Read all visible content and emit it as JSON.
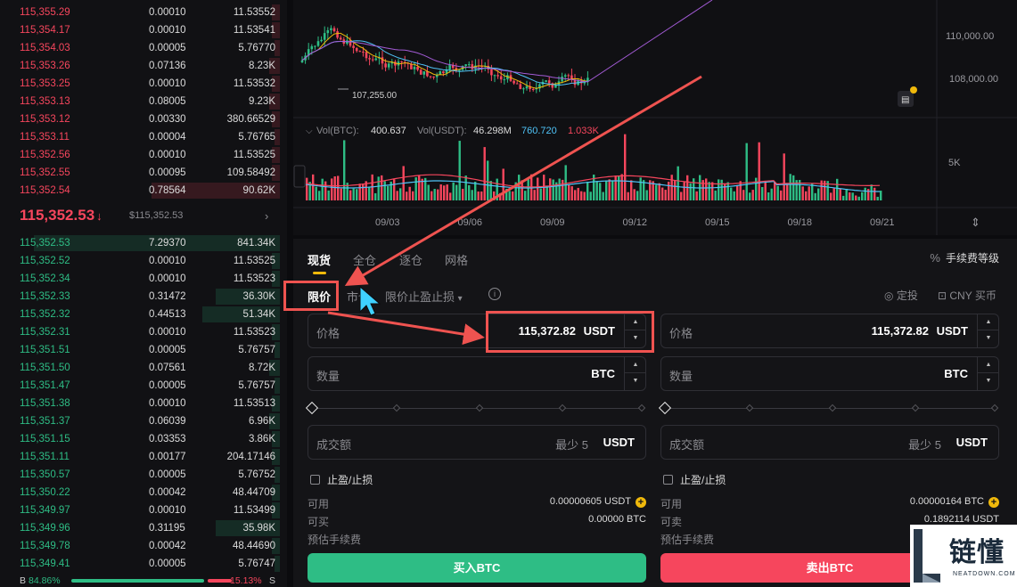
{
  "orderbook": {
    "asks": [
      {
        "price": "115,355.29",
        "qty": "0.00010",
        "total": "11.53552",
        "depth": 0.03
      },
      {
        "price": "115,354.17",
        "qty": "0.00010",
        "total": "11.53541",
        "depth": 0.03
      },
      {
        "price": "115,354.03",
        "qty": "0.00005",
        "total": "5.76770",
        "depth": 0.02
      },
      {
        "price": "115,353.26",
        "qty": "0.07136",
        "total": "8.23K",
        "depth": 0.04
      },
      {
        "price": "115,353.25",
        "qty": "0.00010",
        "total": "11.53532",
        "depth": 0.03
      },
      {
        "price": "115,353.13",
        "qty": "0.08005",
        "total": "9.23K",
        "depth": 0.04
      },
      {
        "price": "115,353.12",
        "qty": "0.00330",
        "total": "380.66529",
        "depth": 0.03
      },
      {
        "price": "115,353.11",
        "qty": "0.00004",
        "total": "5.76765",
        "depth": 0.02
      },
      {
        "price": "115,352.56",
        "qty": "0.00010",
        "total": "11.53525",
        "depth": 0.03
      },
      {
        "price": "115,352.55",
        "qty": "0.00095",
        "total": "109.58492",
        "depth": 0.03
      },
      {
        "price": "115,352.54",
        "qty": "0.78564",
        "total": "90.62K",
        "depth": 0.48
      }
    ],
    "last_price": "115,352.53",
    "last_arrow": "↓",
    "last_usd": "$115,352.53",
    "chevron": "›",
    "bids": [
      {
        "price": "115,352.53",
        "qty": "7.29370",
        "total": "841.34K",
        "depth": 0.92
      },
      {
        "price": "115,352.52",
        "qty": "0.00010",
        "total": "11.53525",
        "depth": 0.03
      },
      {
        "price": "115,352.34",
        "qty": "0.00010",
        "total": "11.53523",
        "depth": 0.03
      },
      {
        "price": "115,352.33",
        "qty": "0.31472",
        "total": "36.30K",
        "depth": 0.24
      },
      {
        "price": "115,352.32",
        "qty": "0.44513",
        "total": "51.34K",
        "depth": 0.29
      },
      {
        "price": "115,352.31",
        "qty": "0.00010",
        "total": "11.53523",
        "depth": 0.03
      },
      {
        "price": "115,351.51",
        "qty": "0.00005",
        "total": "5.76757",
        "depth": 0.02
      },
      {
        "price": "115,351.50",
        "qty": "0.07561",
        "total": "8.72K",
        "depth": 0.04
      },
      {
        "price": "115,351.47",
        "qty": "0.00005",
        "total": "5.76757",
        "depth": 0.02
      },
      {
        "price": "115,351.38",
        "qty": "0.00010",
        "total": "11.53513",
        "depth": 0.03
      },
      {
        "price": "115,351.37",
        "qty": "0.06039",
        "total": "6.96K",
        "depth": 0.04
      },
      {
        "price": "115,351.15",
        "qty": "0.03353",
        "total": "3.86K",
        "depth": 0.03
      },
      {
        "price": "115,351.11",
        "qty": "0.00177",
        "total": "204.17146",
        "depth": 0.03
      },
      {
        "price": "115,350.57",
        "qty": "0.00005",
        "total": "5.76752",
        "depth": 0.02
      },
      {
        "price": "115,350.22",
        "qty": "0.00042",
        "total": "48.44709",
        "depth": 0.03
      },
      {
        "price": "115,349.97",
        "qty": "0.00010",
        "total": "11.53499",
        "depth": 0.03
      },
      {
        "price": "115,349.96",
        "qty": "0.31195",
        "total": "35.98K",
        "depth": 0.24
      },
      {
        "price": "115,349.78",
        "qty": "0.00042",
        "total": "48.44690",
        "depth": 0.03
      },
      {
        "price": "115,349.41",
        "qty": "0.00005",
        "total": "5.76747",
        "depth": 0.02
      }
    ],
    "ratio": {
      "b_label": "B",
      "b_pct": "84.86%",
      "s_pct": "15.13%",
      "s_label": "S",
      "b_fraction": 0.8486
    }
  },
  "chart": {
    "price_labels": [
      "110,000.00",
      "108,000.00"
    ],
    "low_marker": "107,255.00",
    "vol_header": {
      "vol_btc_label": "Vol(BTC):",
      "vol_btc": "400.637",
      "vol_usdt_label": "Vol(USDT):",
      "vol_usdt": "46.298M",
      "ma1": "760.720",
      "ma2": "1.033K"
    },
    "vol_axis_label": "5K",
    "dates": [
      "09/03",
      "09/06",
      "09/09",
      "09/12",
      "09/15",
      "09/18",
      "09/21"
    ],
    "colors": {
      "up": "#2ebd85",
      "down": "#f6465d",
      "ma_yellow": "#f0b90b",
      "ma_purple": "#a35bd6",
      "ma_cyan": "#4fc3f7"
    }
  },
  "trade": {
    "tabs": [
      "现货",
      "全仓",
      "逐仓",
      "网格"
    ],
    "fee_icon": "%",
    "fee_level": "手续费等级",
    "order_types": [
      "限价",
      "市价",
      "限价止盈止损"
    ],
    "dropdown_caret": "▾",
    "info_glyph": "i",
    "fixed_cast": "定投",
    "cny_buy": "CNY 买币",
    "buy": {
      "price_label": "价格",
      "price_value": "115,372.82",
      "price_unit": "USDT",
      "amount_label": "数量",
      "amount_unit": "BTC",
      "total_label": "成交额",
      "total_min": "最少 5",
      "total_unit": "USDT",
      "tpsl_label": "止盈/止损",
      "avail_label": "可用",
      "avail_value": "0.00000605 USDT",
      "can_label": "可买",
      "can_value": "0.00000 BTC",
      "fee_label": "预估手续费",
      "button": "买入BTC"
    },
    "sell": {
      "price_label": "价格",
      "price_value": "115,372.82",
      "price_unit": "USDT",
      "amount_label": "数量",
      "amount_unit": "BTC",
      "total_label": "成交额",
      "total_min": "最少 5",
      "total_unit": "USDT",
      "tpsl_label": "止盈/止损",
      "avail_label": "可用",
      "avail_value": "0.00000164 BTC",
      "can_label": "可卖",
      "can_value": "0.1892114 USDT",
      "fee_label": "预估手续费",
      "button": "卖出BTC"
    },
    "plus_glyph": "+",
    "step_up": "▲",
    "step_down": "▼"
  },
  "watermark": {
    "cn": "链懂",
    "en": "NEATDOWN.COM"
  }
}
